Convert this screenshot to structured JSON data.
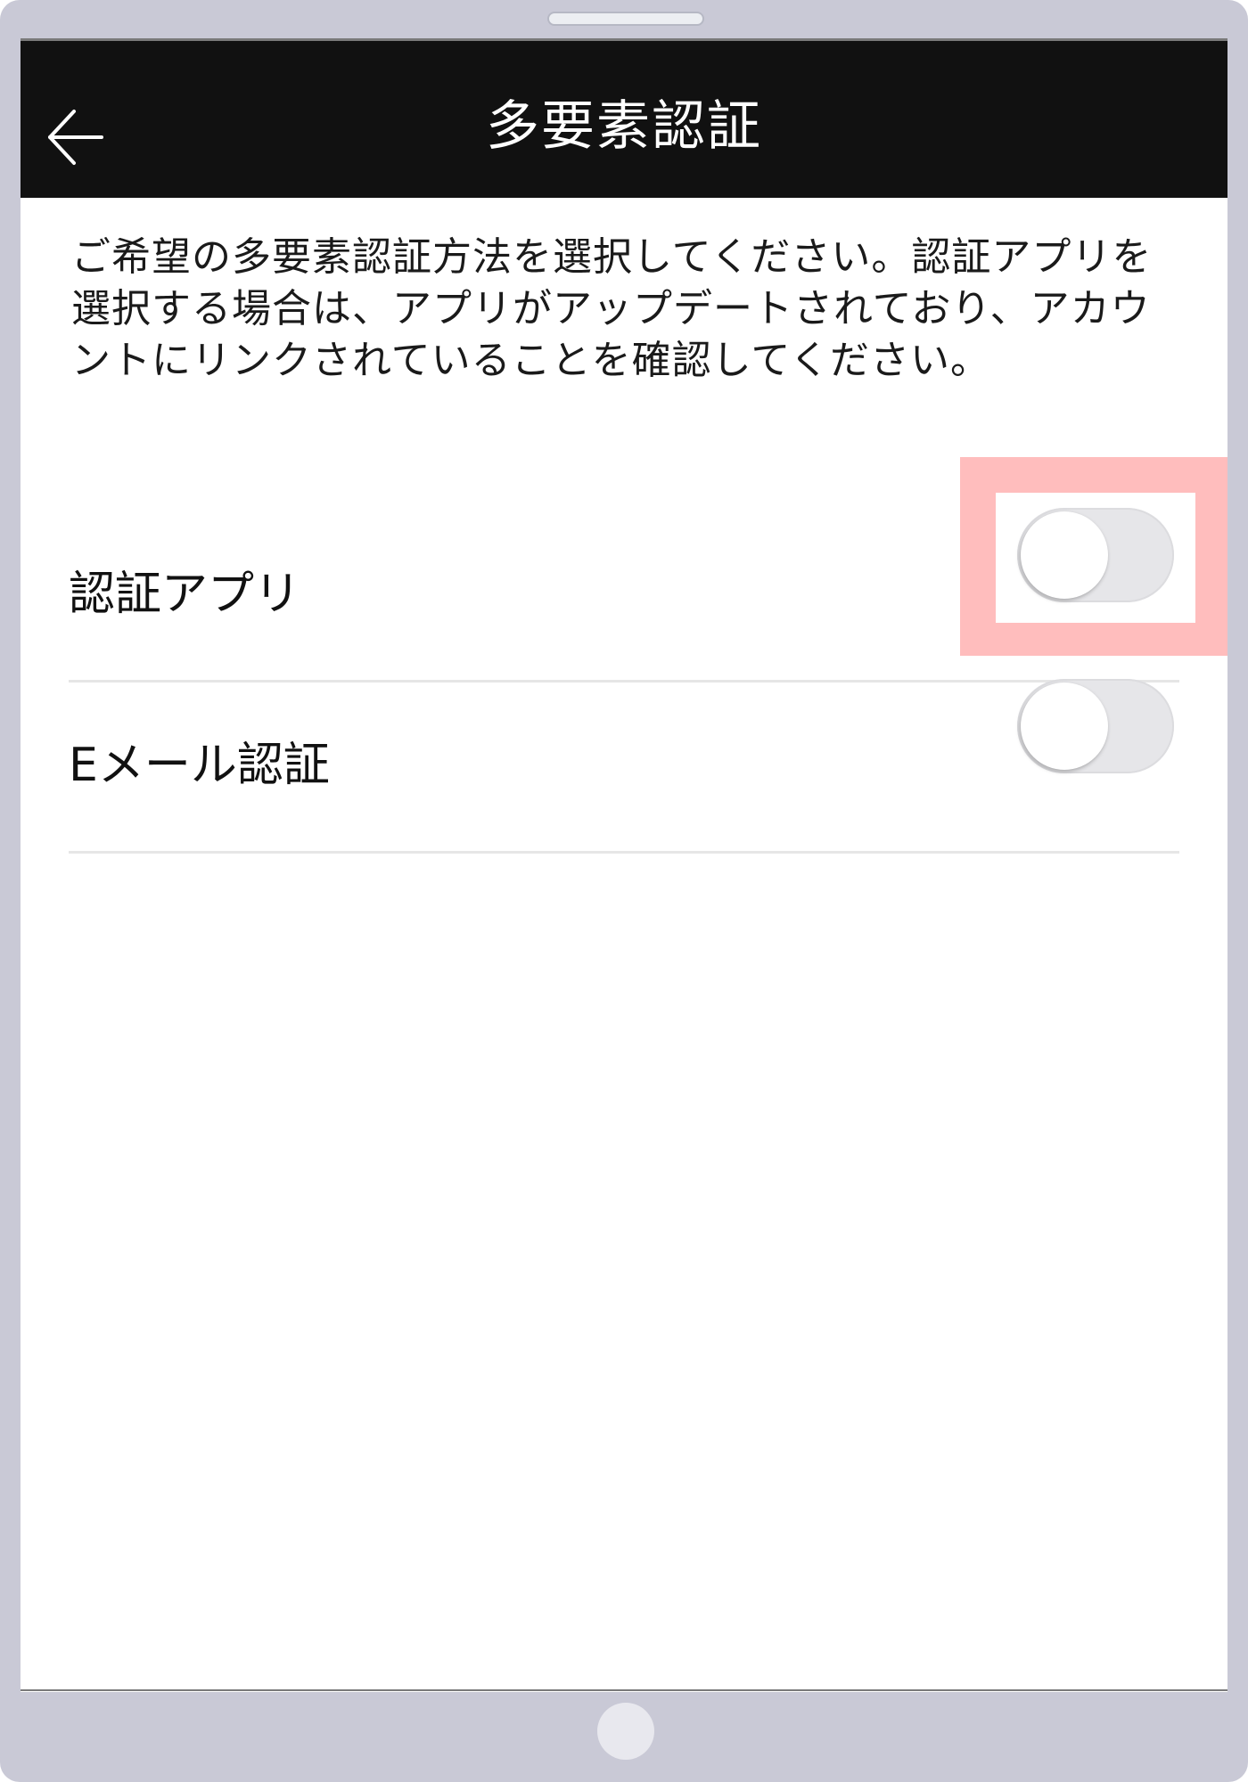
{
  "header": {
    "title": "多要素認証",
    "back_icon": "arrow-left-icon"
  },
  "description": "ご希望の多要素認証方法を選択してください。認証アプリを選択する場合は、アプリがアップデートされており、アカウントにリンクされていることを確認してください。",
  "options": [
    {
      "label": "認証アプリ",
      "enabled": false,
      "highlighted": true
    },
    {
      "label": "Eメール認証",
      "enabled": false,
      "highlighted": false
    }
  ],
  "colors": {
    "header_bg": "#111111",
    "device_frame": "#c9c9d6",
    "highlight": "#ffbdbd",
    "toggle_off": "#e6e6e9"
  }
}
